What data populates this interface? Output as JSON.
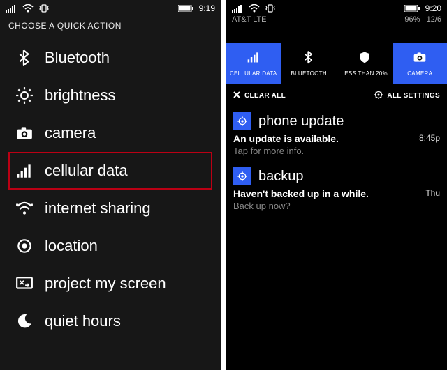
{
  "left": {
    "status": {
      "time": "9:19"
    },
    "title": "CHOOSE A QUICK ACTION",
    "items": [
      {
        "icon": "bluetooth",
        "label": "Bluetooth",
        "highlight": false
      },
      {
        "icon": "brightness",
        "label": "brightness",
        "highlight": false
      },
      {
        "icon": "camera",
        "label": "camera",
        "highlight": false
      },
      {
        "icon": "signal",
        "label": "cellular data",
        "highlight": true
      },
      {
        "icon": "wifi-share",
        "label": "internet sharing",
        "highlight": false
      },
      {
        "icon": "location",
        "label": "location",
        "highlight": false
      },
      {
        "icon": "project",
        "label": "project my screen",
        "highlight": false
      },
      {
        "icon": "moon",
        "label": "quiet hours",
        "highlight": false
      }
    ]
  },
  "right": {
    "status": {
      "time": "9:20",
      "carrier": "AT&T LTE",
      "battery_pct": "96%",
      "date": "12/6"
    },
    "tiles": [
      {
        "icon": "signal",
        "label": "CELLULAR DATA",
        "active": true
      },
      {
        "icon": "bluetooth",
        "label": "BLUETOOTH",
        "active": false
      },
      {
        "icon": "shield",
        "label": "LESS THAN 20%",
        "active": false
      },
      {
        "icon": "camera",
        "label": "CAMERA",
        "active": true
      }
    ],
    "clear_all": "CLEAR ALL",
    "all_settings": "ALL SETTINGS",
    "notifications": [
      {
        "title": "phone update",
        "main": "An update is available.",
        "sub": "Tap for more info.",
        "time": "8:45p"
      },
      {
        "title": "backup",
        "main": "Haven't backed up in a while.",
        "sub": "Back up now?",
        "time": "Thu"
      }
    ]
  }
}
